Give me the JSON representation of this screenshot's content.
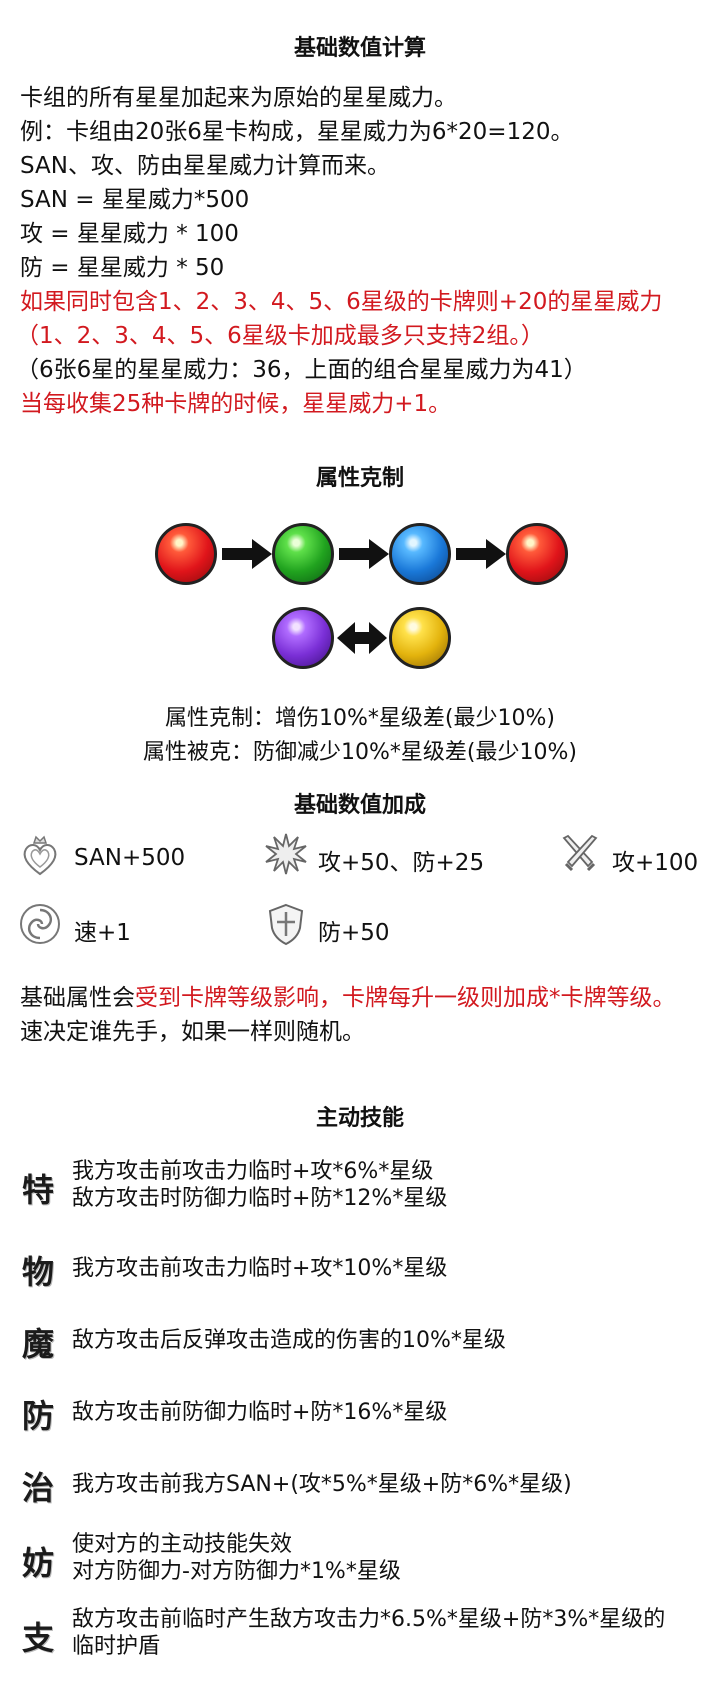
{
  "section1": {
    "title": "基础数值计算",
    "lines": [
      "卡组的所有星星加起来为原始的星星威力。",
      "例：卡组由20张6星卡构成，星星威力为6*20=120。",
      "SAN、攻、防由星星威力计算而来。",
      "SAN = 星星威力*500",
      "攻 = 星星威力 * 100",
      "防 = 星星威力 * 50",
      "如果同时包含1、2、3、4、5、6星级的卡牌则+20的星星威力",
      "（1、2、3、4、5、6星级卡加成最多只支持2组。）",
      "（6张6星的星星威力：36，上面的组合星星威力为41）",
      "当每收集25种卡牌的时候，星星威力+1。"
    ]
  },
  "section2": {
    "title": "属性克制",
    "orbs_row1": [
      "red-orb",
      "green-orb",
      "blue-orb",
      "red-orb"
    ],
    "orbs_row2": [
      "purple-orb",
      "yellow-orb"
    ],
    "line1": "属性克制：增伤10%*星级差(最少10%)",
    "line2": "属性被克：防御减少10%*星级差(最少10%)"
  },
  "section3": {
    "title": "基础数值加成",
    "bonuses": [
      {
        "icon": "heart-crown-icon",
        "text": "SAN+500"
      },
      {
        "icon": "starburst-icon",
        "text": "攻+50、防+25"
      },
      {
        "icon": "crossed-swords-icon",
        "text": "攻+100"
      },
      {
        "icon": "swirl-icon",
        "text": "速+1"
      },
      {
        "icon": "shield-icon",
        "text": "防+50"
      }
    ],
    "note_prefix": "基础属性会",
    "note_red": "受到卡牌等级影响，卡牌每升一级则加成*卡牌等级。",
    "note2": "速决定谁先手，如果一样则随机。"
  },
  "section4": {
    "title": "主动技能",
    "skills": [
      {
        "glyph": "特",
        "lines": [
          "我方攻击前攻击力临时+攻*6%*星级",
          "敌方攻击时防御力临时+防*12%*星级"
        ]
      },
      {
        "glyph": "物",
        "lines": [
          "我方攻击前攻击力临时+攻*10%*星级"
        ]
      },
      {
        "glyph": "魔",
        "lines": [
          "敌方攻击后反弹攻击造成的伤害的10%*星级"
        ]
      },
      {
        "glyph": "防",
        "lines": [
          "敌方攻击前防御力临时+防*16%*星级"
        ]
      },
      {
        "glyph": "治",
        "lines": [
          "我方攻击前我方SAN+(攻*5%*星级+防*6%*星级)"
        ]
      },
      {
        "glyph": "妨",
        "lines": [
          "使对方的主动技能失效",
          "对方防御力-对方防御力*1%*星级"
        ]
      },
      {
        "glyph": "支",
        "lines": [
          "敌方攻击前临时产生敌方攻击力*6.5%*星级+防*3%*星级的",
          "临时护盾"
        ]
      }
    ]
  },
  "colors": {
    "red_text": "#d2191f",
    "black_text": "#111111"
  }
}
